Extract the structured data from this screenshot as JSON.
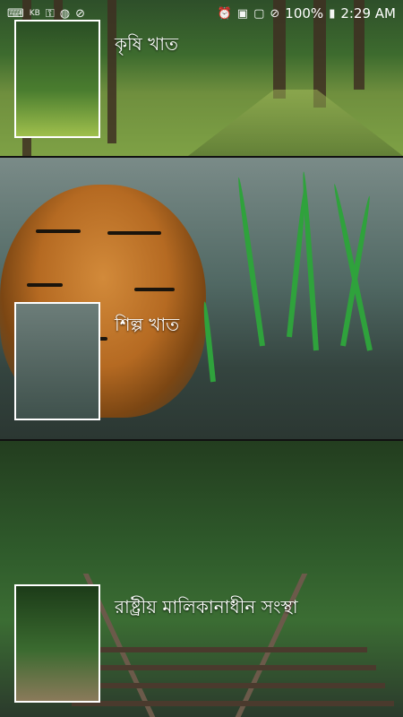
{
  "status_bar": {
    "left_icons": [
      "kbd-icon",
      "key-icon",
      "globe-icon",
      "signal-off-icon"
    ],
    "right_icons": [
      "alarm-icon",
      "sim-1-icon",
      "screen-icon",
      "dnd-icon",
      "battery-icon"
    ],
    "kb_label": "KB",
    "battery": "100%",
    "time": "2:29 AM"
  },
  "sections": [
    {
      "label": "কৃষি খাত"
    },
    {
      "label": "শিল্প খাত"
    },
    {
      "label": "রাষ্ট্রীয় মালিকানাধীন সংস্থা"
    }
  ],
  "colors": {
    "status_text": "#ffffff",
    "thumb_border": "#ffffff"
  }
}
